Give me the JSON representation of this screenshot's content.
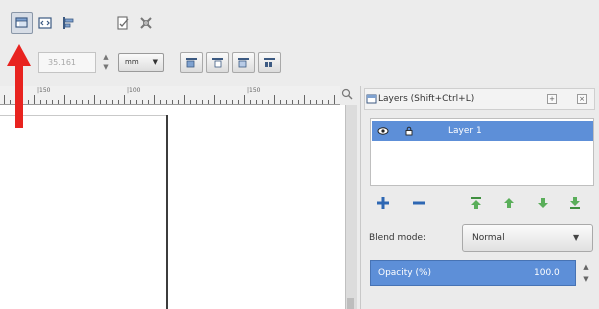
{
  "toolbar": {
    "buttons": [
      {
        "icon": "layers-dialog-icon",
        "active": true
      },
      {
        "icon": "xml-editor-icon"
      },
      {
        "icon": "align-distribute-icon"
      },
      {
        "icon": "document-properties-icon"
      },
      {
        "icon": "preferences-icon"
      }
    ]
  },
  "tool_controls": {
    "value": "35.161",
    "unit": "mm",
    "align_icons": [
      "raise-to-top-icon",
      "raise-icon",
      "lower-icon",
      "lower-to-bottom-icon"
    ]
  },
  "ruler": {
    "labels": [
      "|150",
      "|100",
      "|150"
    ]
  },
  "layers_panel": {
    "title": "Layers (Shift+Ctrl+L)",
    "layers": [
      {
        "name": "Layer 1",
        "selected": true
      }
    ],
    "blend_mode_label": "Blend mode:",
    "blend_mode_value": "Normal",
    "opacity_label": "Opacity (%)",
    "opacity_value": "100.0"
  },
  "colors": {
    "selection": "#5d8fd8",
    "annotation_arrow": "#e8231f"
  }
}
